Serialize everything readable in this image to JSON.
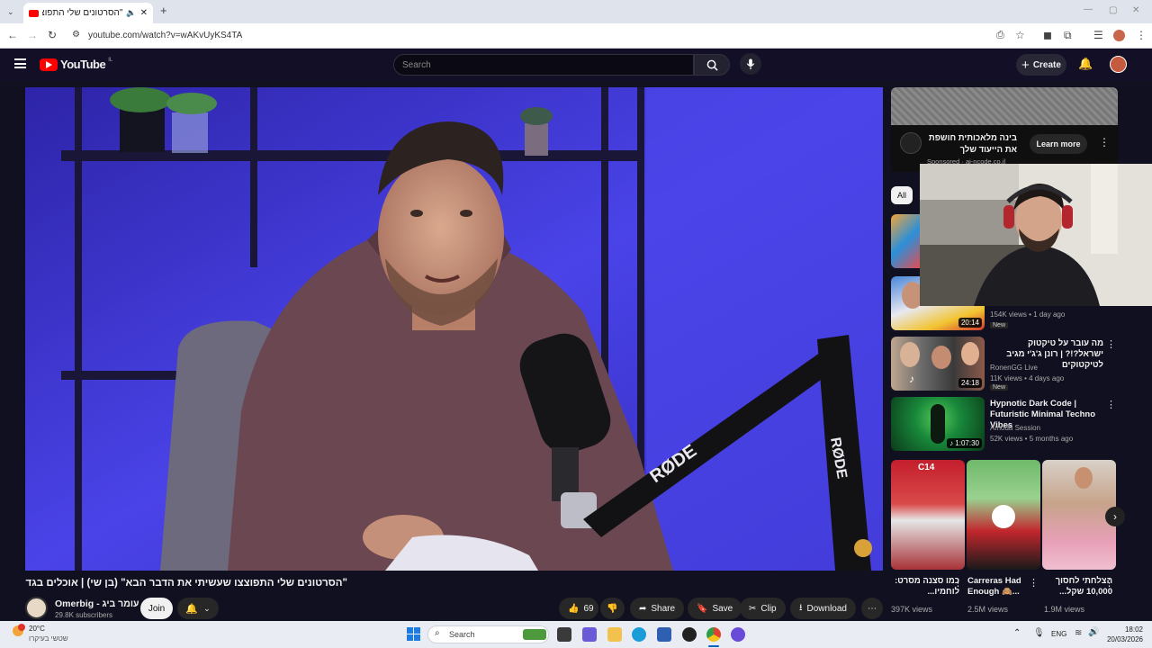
{
  "browser": {
    "tab_title": "\"הסרטונים שלי התפוצצו ש...",
    "url": "youtube.com/watch?v=wAKvUyKS4TA"
  },
  "masthead": {
    "logo_text": "YouTube",
    "country": "IL",
    "search_placeholder": "Search",
    "create_label": "Create"
  },
  "video": {
    "title": "\"הסרטונים שלי התפוצצו שעשיתי את הדבר הבא\" (בן שי) | אוכלים בגדול",
    "channel_name": "Omerbig - עומר ביג",
    "subscribers": "29.8K subscribers",
    "join_label": "Join",
    "likes": "69",
    "share_label": "Share",
    "save_label": "Save",
    "clip_label": "Clip",
    "download_label": "Download"
  },
  "ad": {
    "title": "בינה מלאכותית חושפת את הייעוד שלך",
    "sponsored": "Sponsored · ai-ncode.co.il",
    "cta": "Learn more"
  },
  "chips": {
    "all": "All"
  },
  "recommendations": [
    {
      "title": "",
      "channel": "",
      "meta": "154K views • 1 day ago",
      "badge": "New",
      "duration": "20:14"
    },
    {
      "title": "מה עובר על טיקטוק ישראל?!? | רונן ג'ג'י מגיב לטיקטוקים",
      "channel": "RonenGG Live",
      "meta": "11K views • 4 days ago",
      "badge": "New",
      "duration": "24:18"
    },
    {
      "title": "Hypnotic Dark Code | Futuristic Minimal Techno Vibes",
      "channel": "Amoda Session",
      "meta": "52K views • 5 months ago",
      "badge": "",
      "duration": "1:07:30"
    }
  ],
  "shorts": [
    {
      "title": "כמו סצנה מסרט: לוחמיו...",
      "views": "397K views",
      "overlay": "C14"
    },
    {
      "title": "Carreras Had Enough 🙈...",
      "views": "2.5M views",
      "overlay": ""
    },
    {
      "title": "הצלחתי לחסוך 10,000 שקל...",
      "views": "1.9M views",
      "overlay": ""
    }
  ],
  "taskbar": {
    "weather_temp": "20°C",
    "weather_desc": "שטשי בעיקרו",
    "search_label": "Search",
    "lang": "ENG",
    "time": "18:02",
    "date": "20/03/2026"
  },
  "colors": {
    "yt_red": "#ff0000",
    "bg": "#0f0f0f",
    "accent_blue": "#0067c0"
  }
}
